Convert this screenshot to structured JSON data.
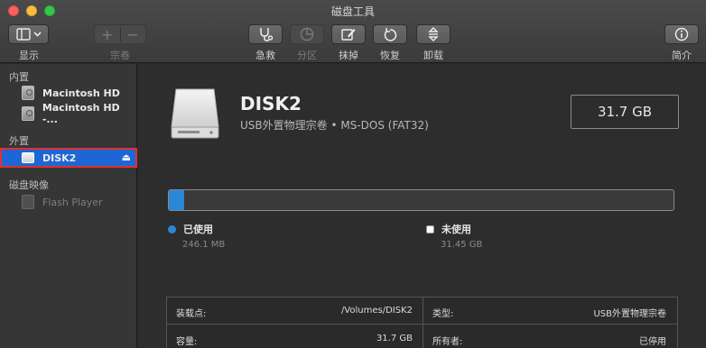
{
  "window": {
    "title": "磁盘工具"
  },
  "toolbar": {
    "view_label": "显示",
    "volume_label": "宗卷",
    "first_aid_label": "急救",
    "partition_label": "分区",
    "erase_label": "抹掉",
    "restore_label": "恢复",
    "unmount_label": "卸载",
    "info_label": "简介"
  },
  "sidebar": {
    "internal_title": "内置",
    "internal_items": [
      "Macintosh HD",
      "Macintosh HD -..."
    ],
    "external_title": "外置",
    "external_items": [
      "DISK2"
    ],
    "images_title": "磁盘映像",
    "image_items": [
      "Flash Player"
    ]
  },
  "disk": {
    "name": "DISK2",
    "subtitle": "USB外置物理宗卷 • MS-DOS (FAT32)",
    "capacity": "31.7 GB"
  },
  "usage": {
    "used_fraction": 0.008,
    "used_label": "已使用",
    "used_value": "246.1 MB",
    "free_label": "未使用",
    "free_value": "31.45 GB"
  },
  "info": {
    "mount_point_key": "装载点:",
    "mount_point_val": "/Volumes/DISK2",
    "type_key": "类型:",
    "type_val": "USB外置物理宗卷",
    "capacity_key": "容量:",
    "capacity_val": "31.7 GB",
    "owner_key": "所有者:",
    "owner_val": "已停用"
  },
  "colors": {
    "accent": "#2a86d6",
    "selection": "#1f66d5",
    "highlight_outline": "#e0302f"
  }
}
